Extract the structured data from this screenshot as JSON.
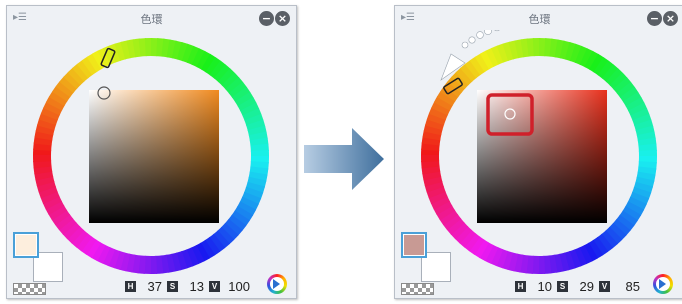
{
  "panels": [
    {
      "title": "色環",
      "menu_icon": "panel-menu-icon",
      "minimize_glyph": "−",
      "close_glyph": "×",
      "hue_label": "H",
      "sat_label": "S",
      "val_label": "V",
      "h": "37",
      "s": "13",
      "v": "100",
      "main_color": "#fdeedd",
      "sub_color": "#ffffff",
      "square_hue_color": "#f08a1f"
    },
    {
      "title": "色環",
      "menu_icon": "panel-menu-icon",
      "minimize_glyph": "−",
      "close_glyph": "×",
      "hue_label": "H",
      "sat_label": "S",
      "val_label": "V",
      "h": "10",
      "s": "29",
      "v": "85",
      "main_color": "#c89a94",
      "sub_color": "#ffffff",
      "square_hue_color": "#e8301c",
      "highlight_color": "#d0202a"
    }
  ],
  "transition_arrow": "arrow-right-icon"
}
